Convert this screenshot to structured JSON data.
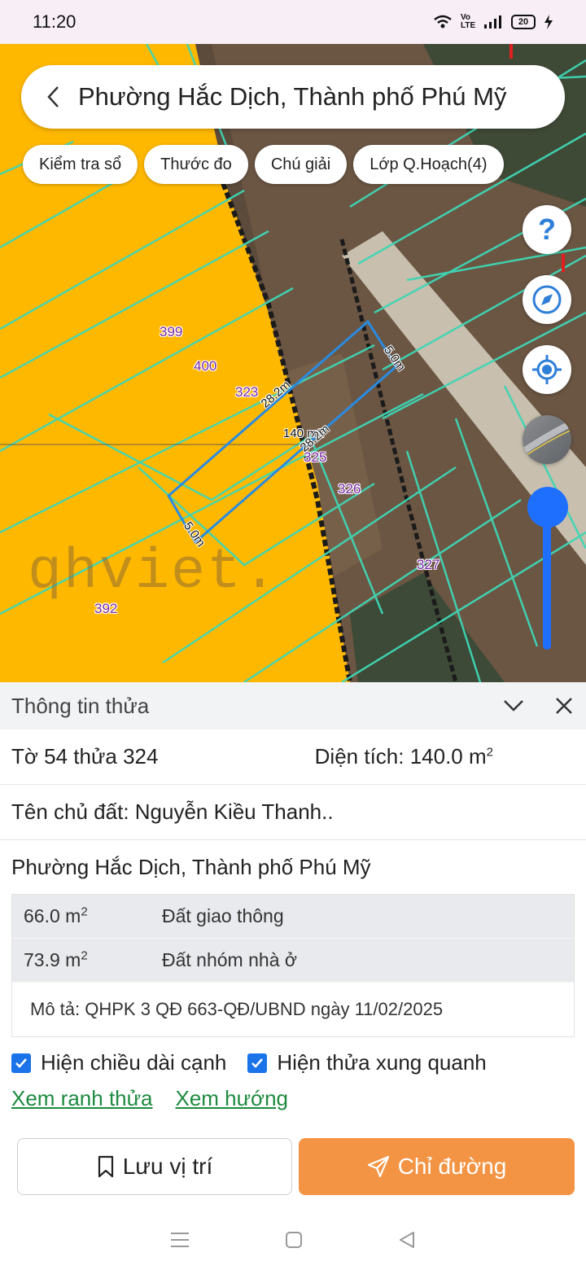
{
  "status": {
    "time": "11:20",
    "network": "Vo LTE",
    "battery": "20"
  },
  "search": {
    "title": "Phường Hắc Dịch, Thành phố Phú Mỹ"
  },
  "chips": [
    "Kiểm tra sổ",
    "Thước đo",
    "Chú giải",
    "Lớp Q.Hoạch(4)"
  ],
  "map_controls": {
    "help": "?",
    "zoom_level": 0.97
  },
  "map": {
    "parcels": [
      "399",
      "400",
      "323",
      "325",
      "326",
      "327",
      "392"
    ],
    "dimensions": {
      "side_a": "5.0m",
      "side_b": "28.2m",
      "area": "140 m2",
      "side_c": "28.2m",
      "side_d": "5.0m"
    },
    "watermark": "qhviet."
  },
  "panel": {
    "title": "Thông tin thửa",
    "parcel_id": "Tờ 54 thửa 324",
    "area_label": "Diện tích: 140.0 m",
    "area_sup": "2",
    "owner": "Tên chủ đất: Nguyễn Kiều Thanh..",
    "address": "Phường Hắc Dịch, Thành phố Phú Mỹ",
    "land_uses": [
      {
        "area": "66.0 m",
        "sup": "2",
        "type": "Đất giao thông"
      },
      {
        "area": "73.9 m",
        "sup": "2",
        "type": "Đất nhóm nhà ở"
      }
    ],
    "description": "Mô tả: QHPK 3 QĐ 663-QĐ/UBND ngày 11/02/2025"
  },
  "options": {
    "show_edge_length": "Hiện chiều dài cạnh",
    "show_neighbors": "Hiện thửa xung quanh"
  },
  "links": {
    "boundary": "Xem ranh thửa",
    "direction": "Xem hướng"
  },
  "buttons": {
    "save": "Lưu vị trí",
    "directions": "Chỉ đường"
  },
  "colors": {
    "accent": "#f39444",
    "link": "#1d8a3f",
    "checkbox": "#1a73e8",
    "zoning_yellow": "#ffb800",
    "parcel_line": "#3fd6b4"
  }
}
